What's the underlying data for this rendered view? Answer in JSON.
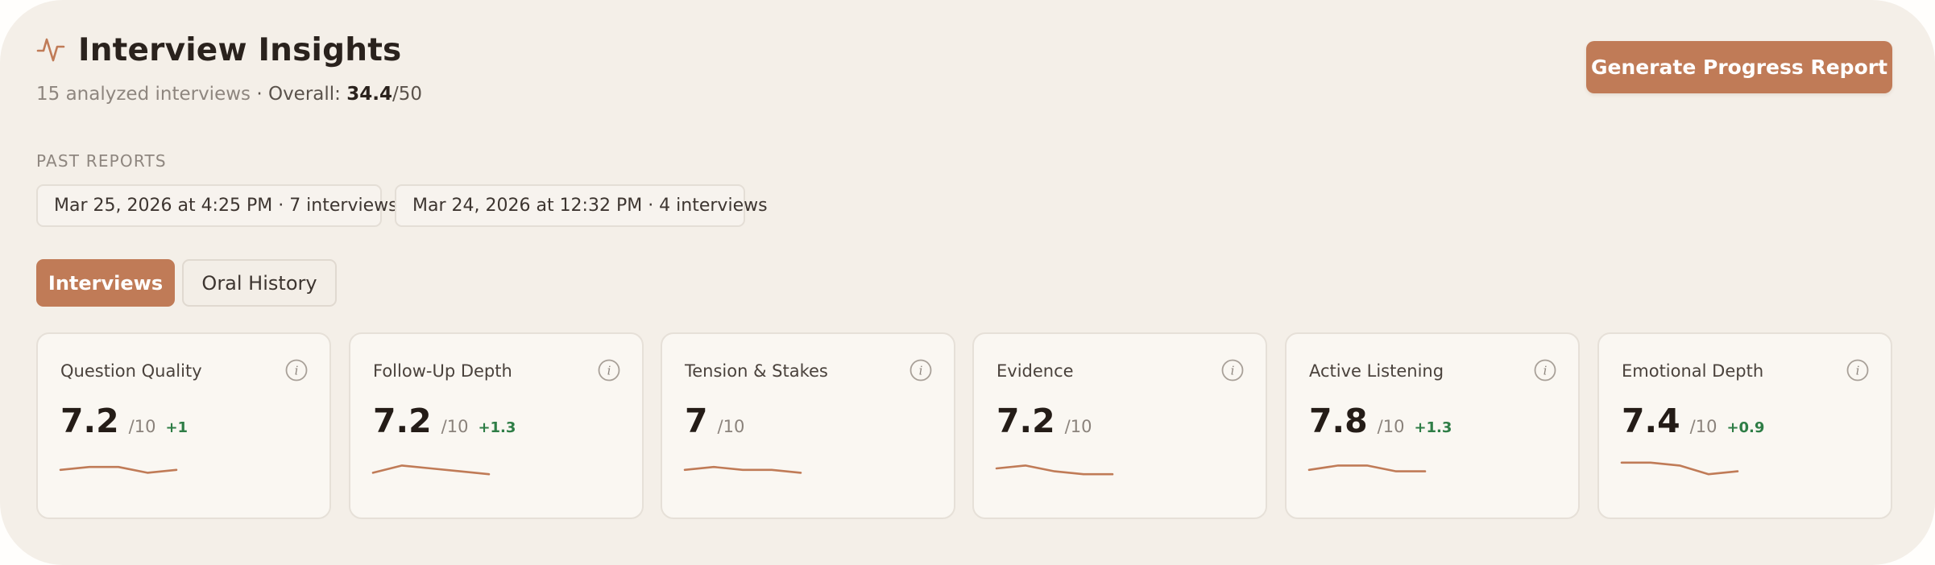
{
  "header": {
    "title": "Interview Insights",
    "title_icon": "activity-pulse-icon",
    "subtitle_count": "15 analyzed interviews",
    "subtitle_separator": " · ",
    "subtitle_overall_label": "Overall: ",
    "subtitle_overall_score": "34.4",
    "subtitle_overall_max": "/50"
  },
  "actions": {
    "generate_label": "Generate Progress Report"
  },
  "past_reports": {
    "label": "PAST REPORTS",
    "items": [
      {
        "label": "Mar 25, 2026 at 4:25 PM · 7 interviews"
      },
      {
        "label": "Mar 24, 2026 at 12:32 PM · 4 interviews"
      }
    ]
  },
  "tabs": [
    {
      "label": "Interviews",
      "active": true
    },
    {
      "label": "Oral History",
      "active": false
    }
  ],
  "metrics": [
    {
      "label": "Question Quality",
      "value": "7.2",
      "outof": "/10",
      "delta": "+1",
      "trend": [
        7.0,
        7.2,
        7.2,
        6.8,
        7.0
      ]
    },
    {
      "label": "Follow-Up Depth",
      "value": "7.2",
      "outof": "/10",
      "delta": "+1.3",
      "trend": [
        6.8,
        7.3,
        7.1,
        6.9,
        6.7
      ]
    },
    {
      "label": "Tension & Stakes",
      "value": "7",
      "outof": "/10",
      "delta": "",
      "trend": [
        7.0,
        7.2,
        7.0,
        7.0,
        6.8
      ]
    },
    {
      "label": "Evidence",
      "value": "7.2",
      "outof": "/10",
      "delta": "",
      "trend": [
        7.1,
        7.3,
        6.9,
        6.7,
        6.7
      ]
    },
    {
      "label": "Active Listening",
      "value": "7.8",
      "outof": "/10",
      "delta": "+1.3",
      "trend": [
        7.0,
        7.3,
        7.3,
        6.9,
        6.9
      ]
    },
    {
      "label": "Emotional Depth",
      "value": "7.4",
      "outof": "/10",
      "delta": "+0.9",
      "trend": [
        7.5,
        7.5,
        7.3,
        6.7,
        6.9
      ]
    }
  ],
  "colors": {
    "accent": "#c07b57",
    "background": "#f4efe8",
    "card": "#faf7f2",
    "positive": "#2e7d46",
    "sparkline": "#c07b57"
  },
  "info_icon": "info-icon"
}
